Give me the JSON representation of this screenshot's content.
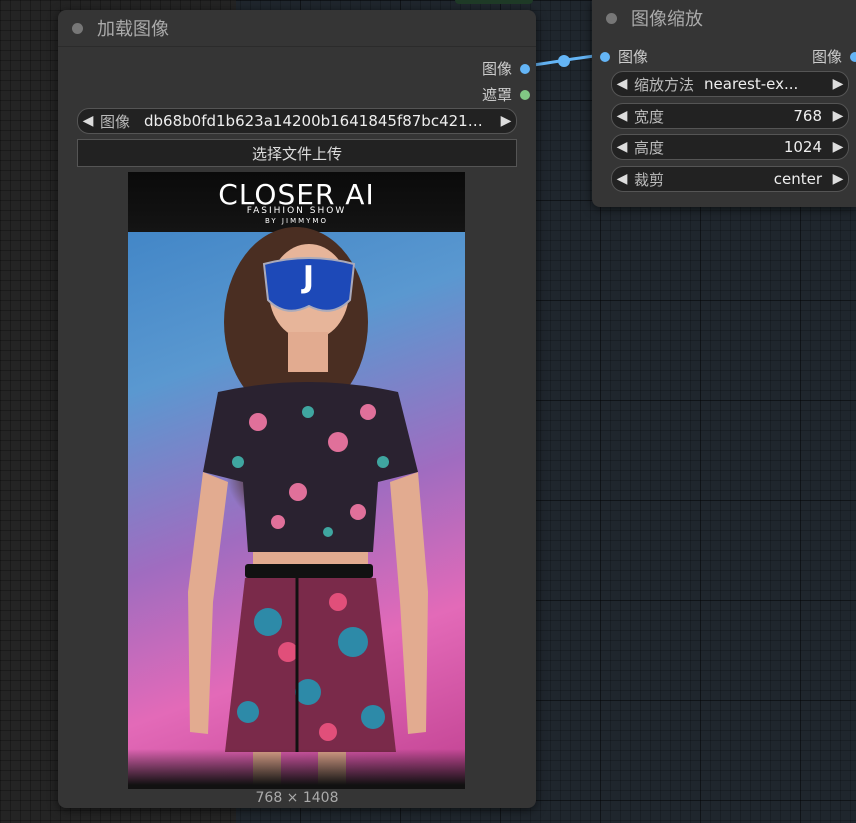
{
  "load_node": {
    "title": "加载图像",
    "outputs": [
      {
        "label": "图像",
        "color": "#64b5f6"
      },
      {
        "label": "遮罩",
        "color": "#81c784"
      }
    ],
    "image_widget": {
      "label": "图像",
      "value": "db68b0fd1b623a14200b1641845f87bc421b..."
    },
    "upload_label": "选择文件上传",
    "preview": {
      "brand_title": "CLOSER AI",
      "brand_subtitle": "FASIHION SHOW",
      "brand_byline": "BY JIMMYMO",
      "mask_letter": "J"
    },
    "dimensions": "768 × 1408"
  },
  "scale_node": {
    "title": "图像缩放",
    "input": {
      "label": "图像",
      "color": "#64b5f6"
    },
    "output": {
      "label": "图像",
      "color": "#64b5f6"
    },
    "widgets": [
      {
        "label": "缩放方法",
        "value": "nearest-ex..."
      },
      {
        "label": "宽度",
        "value": "768"
      },
      {
        "label": "高度",
        "value": "1024"
      },
      {
        "label": "裁剪",
        "value": "center"
      }
    ]
  },
  "link_color": "#64b5f6"
}
